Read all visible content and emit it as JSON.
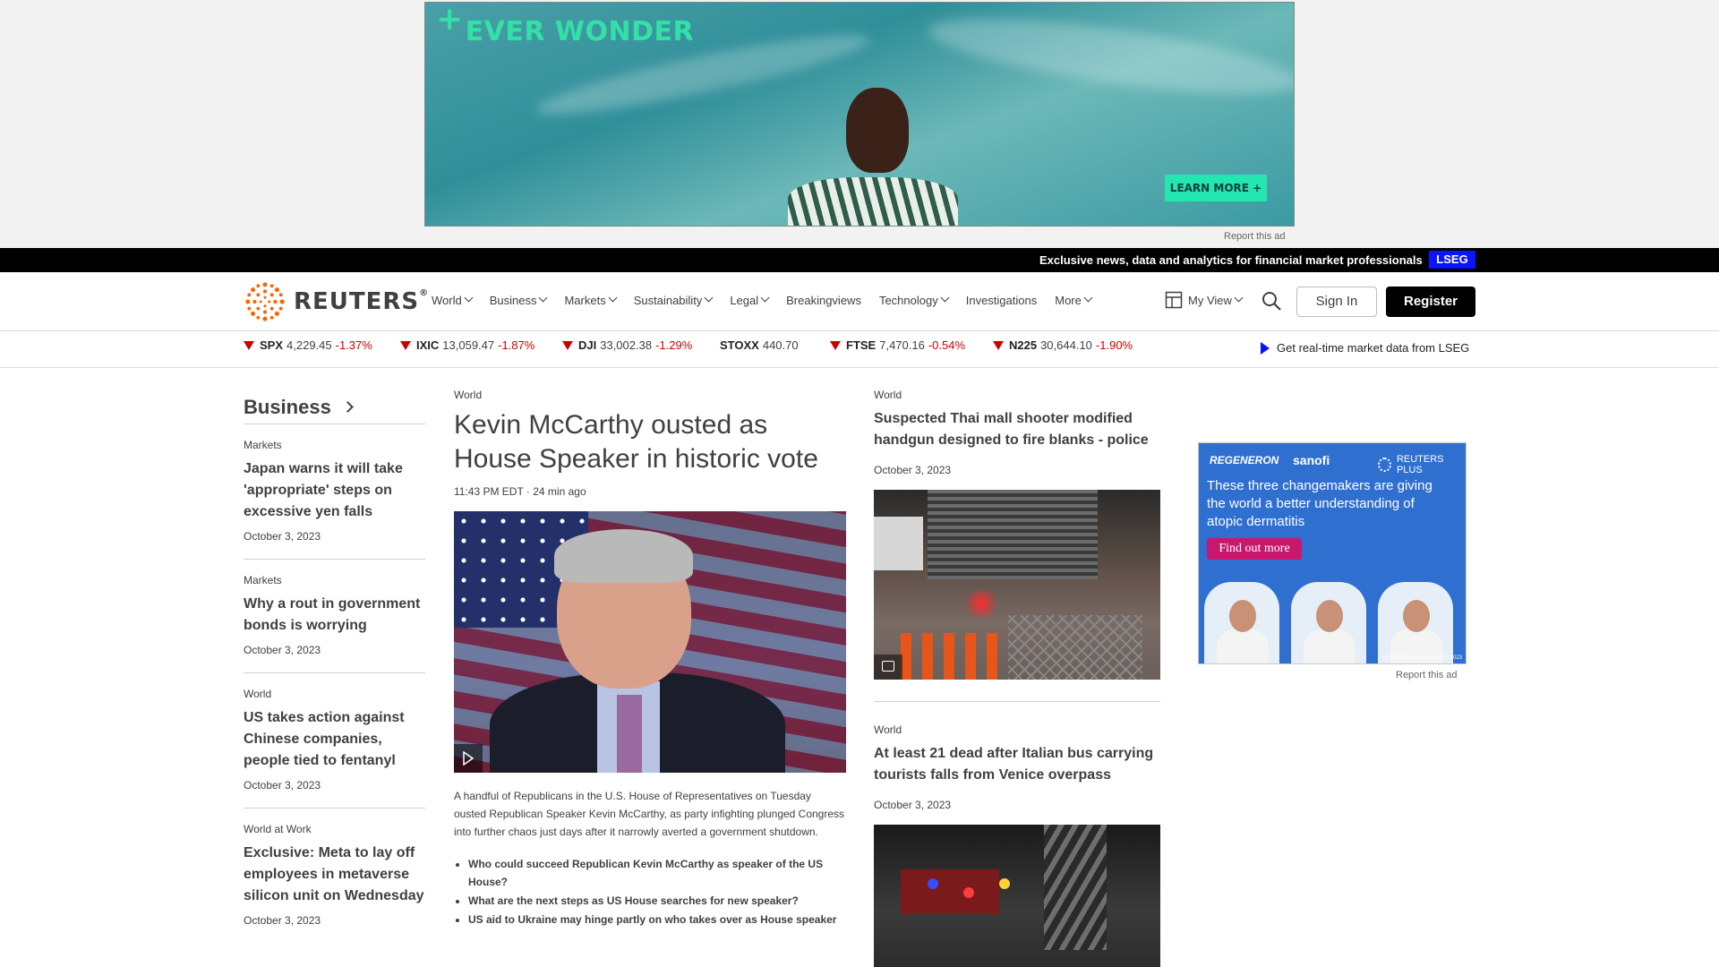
{
  "top_ad": {
    "brand": "EVER WONDER",
    "cta": "LEARN MORE +",
    "report": "Report this ad"
  },
  "black_bar": {
    "text": "Exclusive news, data and analytics for financial market professionals",
    "badge": "LSEG"
  },
  "nav": {
    "logo": "REUTERS",
    "items": [
      {
        "label": "World",
        "dropdown": true
      },
      {
        "label": "Business",
        "dropdown": true
      },
      {
        "label": "Markets",
        "dropdown": true
      },
      {
        "label": "Sustainability",
        "dropdown": true
      },
      {
        "label": "Legal",
        "dropdown": true
      },
      {
        "label": "Breakingviews",
        "dropdown": false
      },
      {
        "label": "Technology",
        "dropdown": true
      },
      {
        "label": "Investigations",
        "dropdown": false
      },
      {
        "label": "More",
        "dropdown": true
      }
    ],
    "my_view": "My View",
    "sign_in": "Sign In",
    "register": "Register"
  },
  "ticker": {
    "items": [
      {
        "symbol": "SPX",
        "value": "4,229.45",
        "change": "-1.37%",
        "down": true
      },
      {
        "symbol": "IXIC",
        "value": "13,059.47",
        "change": "-1.87%",
        "down": true
      },
      {
        "symbol": "DJI",
        "value": "33,002.38",
        "change": "-1.29%",
        "down": true
      },
      {
        "symbol": "STOXX",
        "value": "440.70",
        "change": "",
        "down": false
      },
      {
        "symbol": "FTSE",
        "value": "7,470.16",
        "change": "-0.54%",
        "down": true
      },
      {
        "symbol": "N225",
        "value": "30,644.10",
        "change": "-1.90%",
        "down": true
      }
    ],
    "realtime": "Get real-time market data from LSEG"
  },
  "sidebar": {
    "title": "Business",
    "items": [
      {
        "kicker": "Markets",
        "headline": "Japan warns it will take 'appropriate' steps on excessive yen falls",
        "date": "October 3, 2023"
      },
      {
        "kicker": "Markets",
        "headline": "Why a rout in government bonds is worrying",
        "date": "October 3, 2023"
      },
      {
        "kicker": "World",
        "headline": "US takes action against Chinese companies, people tied to fentanyl",
        "date": "October 3, 2023"
      },
      {
        "kicker": "World at Work",
        "headline": "Exclusive: Meta to lay off employees in metaverse silicon unit on Wednesday",
        "date": "October 3, 2023"
      }
    ]
  },
  "main_story": {
    "kicker": "World",
    "headline": "Kevin McCarthy ousted as House Speaker in historic vote",
    "time": "11:43 PM EDT · 24 min ago",
    "description": "A handful of Republicans in the U.S. House of Representatives on Tuesday ousted Republican Speaker Kevin McCarthy, as party infighting plunged Congress into further chaos just days after it narrowly averted a government shutdown.",
    "related": [
      "Who could succeed Republican Kevin McCarthy as speaker of the US House?",
      "What are the next steps as US House searches for new speaker?",
      "US aid to Ukraine may hinge partly on who takes over as House speaker"
    ]
  },
  "right_stories": [
    {
      "kicker": "World",
      "headline": "Suspected Thai mall shooter modified handgun designed to fire blanks - police",
      "date": "October 3, 2023"
    },
    {
      "kicker": "World",
      "headline": "At least 21 dead after Italian bus carrying tourists falls from Venice overpass",
      "date": "October 3, 2023"
    }
  ],
  "side_ad": {
    "sponsor1": "REGENERON",
    "sponsor2": "sanofi",
    "reuters_plus": "REUTERS PLUS",
    "copy": "These three changemakers are giving the world a better understanding of atopic dermatitis",
    "cta": "Find out more",
    "fine": "DER.23.08.0001 | AUGUST 2023",
    "report": "Report this ad"
  },
  "colors": {
    "accent_orange": "#fa6400",
    "down_red": "#cc0000",
    "lseg_blue": "#0a14ff",
    "ad_teal": "#33e0a6"
  }
}
